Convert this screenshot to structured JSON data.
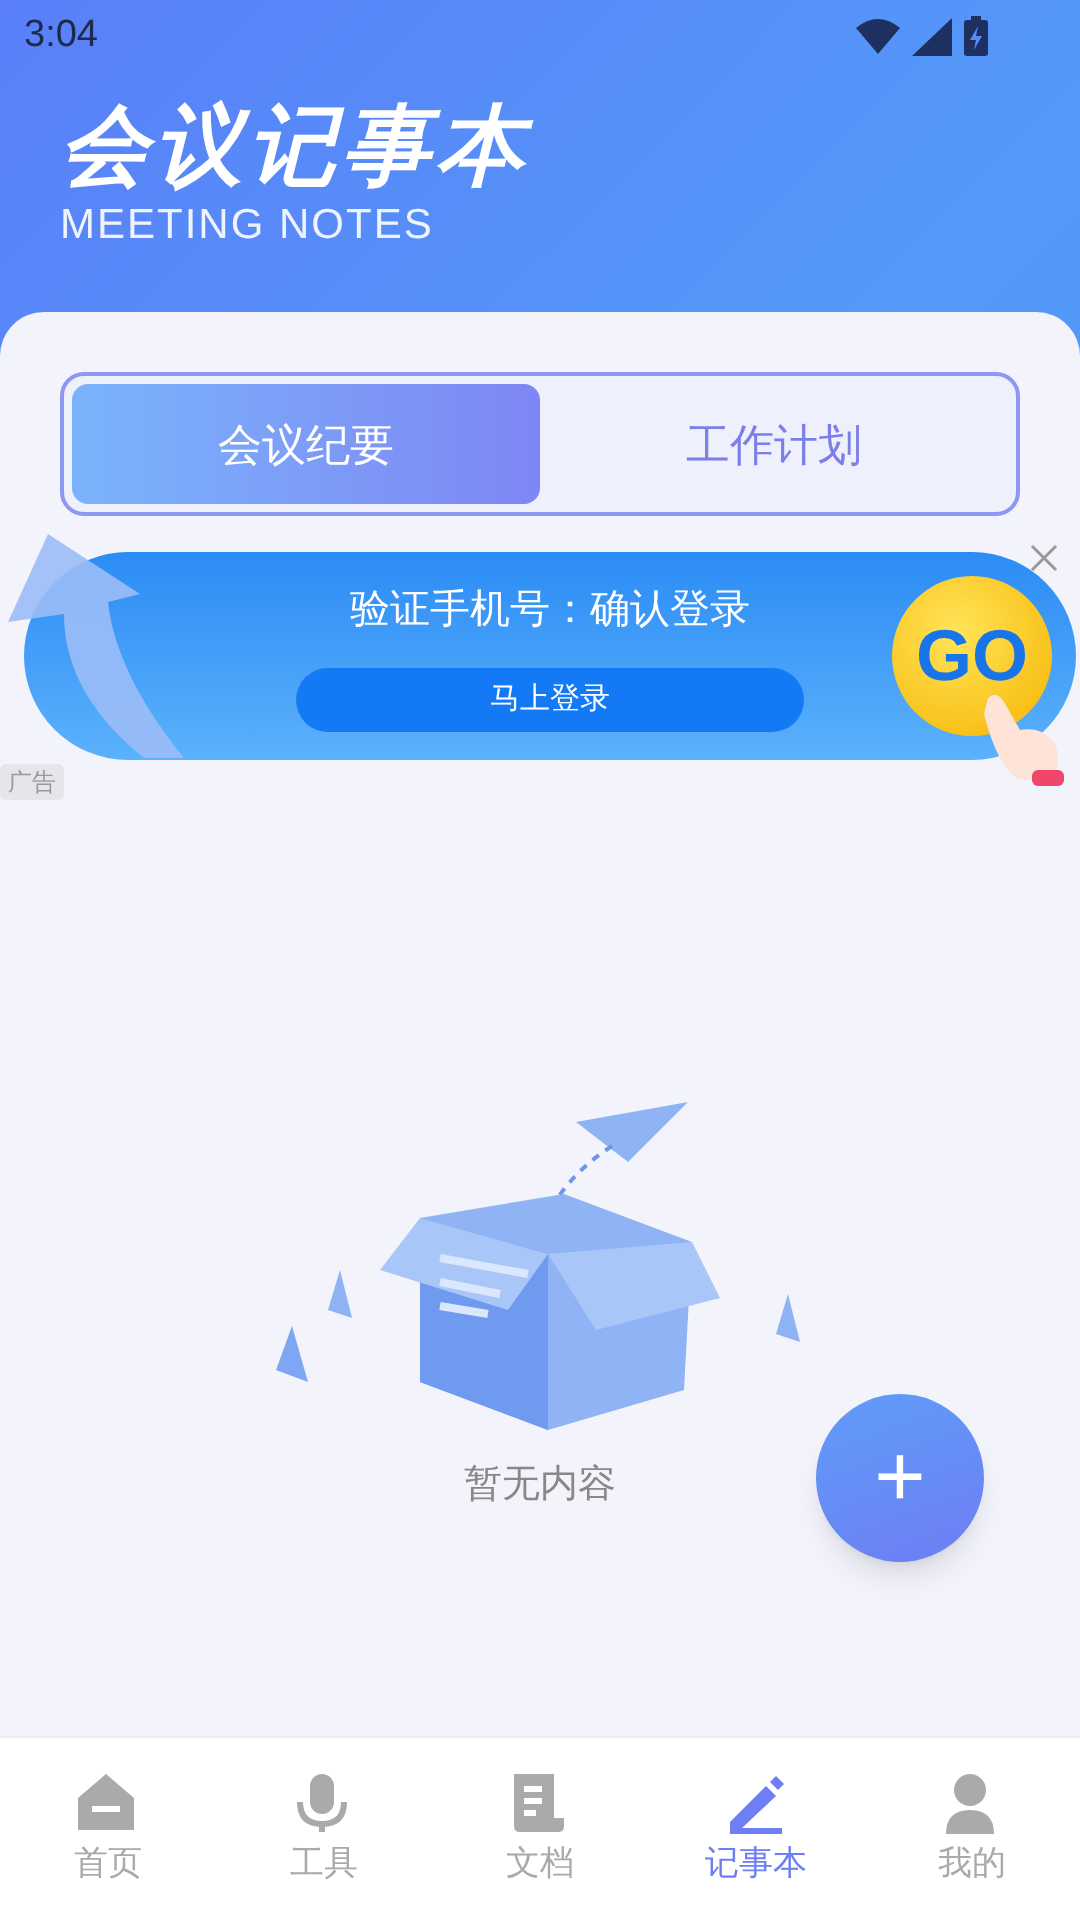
{
  "status_bar": {
    "time": "3:04"
  },
  "header": {
    "title": "会议记事本",
    "subtitle": "MEETING NOTES"
  },
  "tabs": [
    {
      "label": "会议纪要",
      "selected": true
    },
    {
      "label": "工作计划",
      "selected": false
    }
  ],
  "ad": {
    "headline": "验证手机号：确认登录",
    "button": "马上登录",
    "badge": "GO",
    "tag": "广告"
  },
  "empty_state": {
    "message": "暂无内容"
  },
  "fab": {
    "label": "+"
  },
  "bottom_nav": [
    {
      "label": "首页",
      "kind": "home",
      "selected": false
    },
    {
      "label": "工具",
      "kind": "mic",
      "selected": false
    },
    {
      "label": "文档",
      "kind": "doc",
      "selected": false
    },
    {
      "label": "记事本",
      "kind": "pen",
      "selected": true
    },
    {
      "label": "我的",
      "kind": "person",
      "selected": false
    }
  ]
}
